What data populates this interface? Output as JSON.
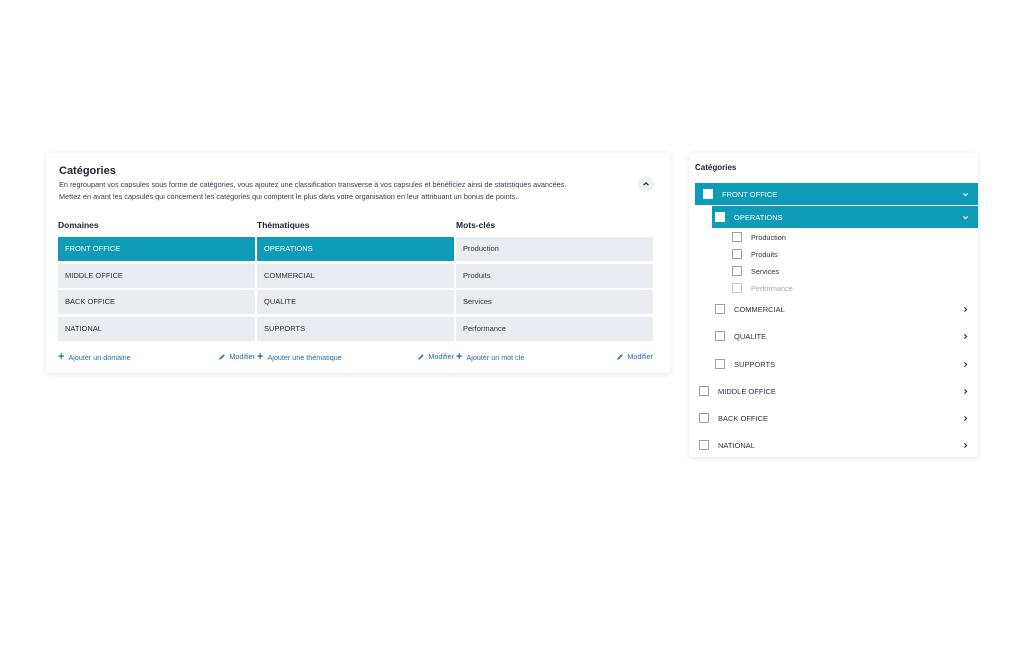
{
  "categories_panel": {
    "title": "Catégories",
    "description_line1": "En regroupant vos capsules sous forme de catégories, vous ajoutez une classification transverse à vos capsules et bénéficiez ainsi de statistiques avancées.",
    "description_line2": "Mettez en avant les capsules qui concernent les catégories qui comptent le plus dans votre organisation en leur attribuant un bonus de points.",
    "collapse_icon": "chevron-up-icon",
    "columns": [
      {
        "header": "Domaines",
        "items": [
          "FRONT OFFICE",
          "MIDDLE OFFICE",
          "BACK OFFICE",
          "NATIONAL"
        ],
        "active_index": 0,
        "add_label": "Ajouter un domaine",
        "edit_label": "Modifier"
      },
      {
        "header": "Thématiques",
        "items": [
          "OPERATIONS",
          "COMMERCIAL",
          "QUALITE",
          "SUPPORTS"
        ],
        "active_index": 0,
        "add_label": "Ajouter une thématique",
        "edit_label": "Modifier"
      },
      {
        "header": "Mots-clés",
        "items": [
          "Production",
          "Produits",
          "Services",
          "Performance"
        ],
        "active_index": -1,
        "add_label": "Ajouter un mot clé",
        "edit_label": "Modifier"
      }
    ],
    "accent_color": "#0e9bb7",
    "link_color": "#1e6fb0"
  },
  "tree_panel": {
    "title": "Catégories",
    "domain_open": "FRONT OFFICE",
    "theme_open": "OPERATIONS",
    "keywords": [
      "Production",
      "Produits",
      "Services",
      "Performance"
    ],
    "other_themes": [
      "COMMERCIAL",
      "QUALITE",
      "SUPPORTS"
    ],
    "other_domains": [
      "MIDDLE OFFICE",
      "BACK OFFICE",
      "NATIONAL"
    ]
  }
}
